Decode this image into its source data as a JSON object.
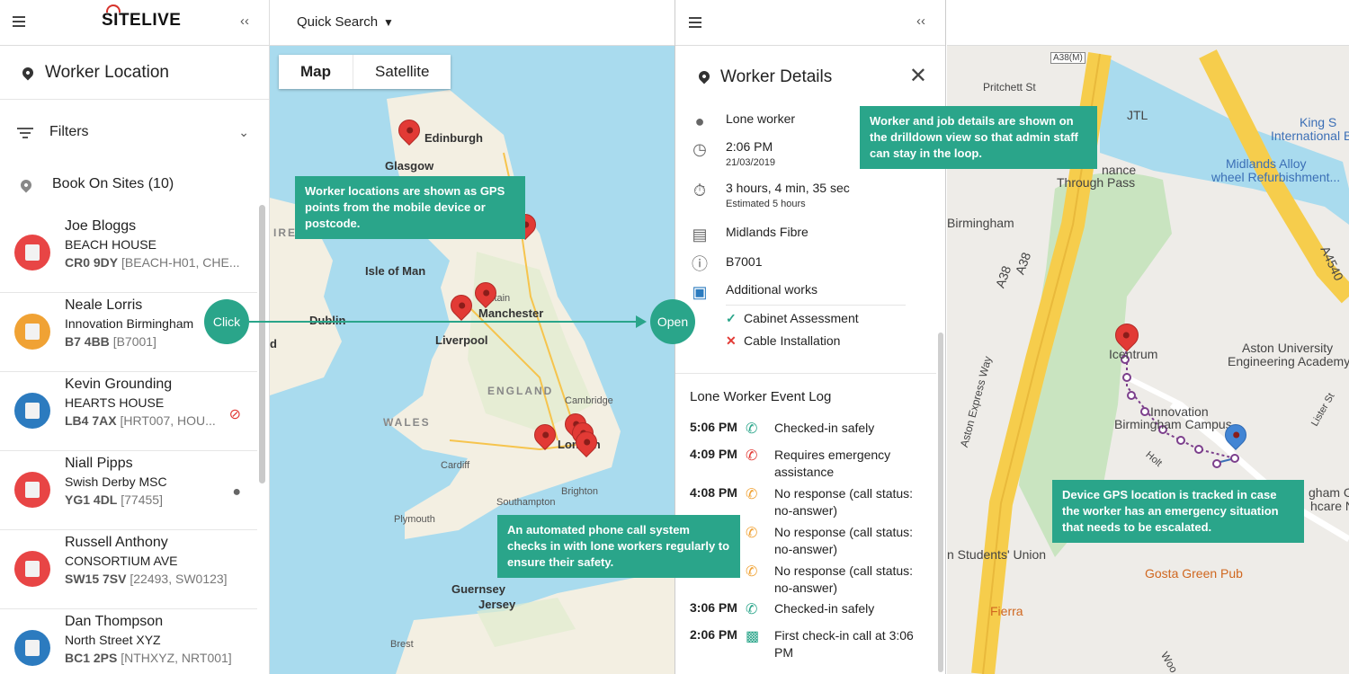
{
  "app": {
    "logo": "SITELIVE"
  },
  "left": {
    "title": "Worker Location",
    "filters_label": "Filters",
    "book_on_sites": "Book On Sites (10)",
    "workers": [
      {
        "name": "Joe Bloggs",
        "site": "BEACH HOUSE",
        "postcode": "CR0 9DY",
        "codes": "[BEACH-H01, CHE...",
        "avatar_color": "#e84545",
        "icon": ""
      },
      {
        "name": "Neale Lorris",
        "site": "Innovation Birmingham",
        "postcode": "B7 4BB",
        "codes": "[B7001]",
        "avatar_color": "#f0a234",
        "icon": ""
      },
      {
        "name": "Kevin Grounding",
        "site": "HEARTS HOUSE",
        "postcode": "LB4 7AX",
        "codes": "[HRT007, HOU...",
        "avatar_color": "#2c7bbf",
        "icon": "no-gps-icon"
      },
      {
        "name": "Niall Pipps",
        "site": "Swish Derby MSC",
        "postcode": "YG1 4DL",
        "codes": "[77455]",
        "avatar_color": "#e84545",
        "icon": "person-icon"
      },
      {
        "name": "Russell Anthony",
        "site": "CONSORTIUM AVE",
        "postcode": "SW15 7SV",
        "codes": "[22493, SW0123]",
        "avatar_color": "#e84545",
        "icon": ""
      },
      {
        "name": "Dan Thompson",
        "site": "North Street XYZ",
        "postcode": "BC1 2PS",
        "codes": "[NTHXYZ, NRT001]",
        "avatar_color": "#2c7bbf",
        "icon": ""
      }
    ]
  },
  "map": {
    "quick_search": "Quick Search",
    "tabs": [
      "Map",
      "Satellite"
    ],
    "labels": {
      "edinburgh": "Edinburgh",
      "glasgow": "Glasgow",
      "ireland": "IRELAND",
      "isle_of_man": "Isle of Man",
      "dublin": "Dublin",
      "d": "d",
      "liverpool": "Liverpool",
      "manchester": "Manchester",
      "britain": "Britain",
      "england": "ENGLAND",
      "wales": "WALES",
      "cambridge": "Cambridge",
      "cardiff": "Cardiff",
      "london": "London",
      "brighton": "Brighton",
      "southampton": "Southampton",
      "plymouth": "Plymouth",
      "guernsey": "Guernsey",
      "jersey": "Jersey",
      "brest": "Brest"
    }
  },
  "details": {
    "title": "Worker Details",
    "worker_type": "Lone worker",
    "time": "2:06 PM",
    "date": "21/03/2019",
    "duration": "3 hours, 4 min, 35 sec",
    "estimated": "Estimated 5 hours",
    "company": "Midlands Fibre",
    "job_code": "B7001",
    "works": "Additional works",
    "tasks": [
      {
        "label": "Cabinet Assessment",
        "status": "done",
        "mark": "✓",
        "color": "#2aa58a"
      },
      {
        "label": "Cable Installation",
        "status": "failed",
        "mark": "✕",
        "color": "#e23a35"
      }
    ],
    "log_title": "Lone Worker Event Log",
    "log": [
      {
        "time": "5:06 PM",
        "message": "Checked-in safely",
        "color": "#2aa58a"
      },
      {
        "time": "4:09 PM",
        "message": "Requires emergency assistance",
        "color": "#e23a35"
      },
      {
        "time": "4:08 PM",
        "message": "No response (call status: no-answer)",
        "color": "#f0a234"
      },
      {
        "time": "",
        "message": "No response (call status: no-answer)",
        "color": "#f0a234"
      },
      {
        "time": "",
        "message": "No response (call status: no-answer)",
        "color": "#f0a234"
      },
      {
        "time": "3:06 PM",
        "message": "Checked-in safely",
        "color": "#2aa58a"
      },
      {
        "time": "2:06 PM",
        "message": "First check-in call at 3:06 PM",
        "color": "#2aa58a"
      }
    ]
  },
  "street": {
    "labels": {
      "a38m": "A38(M)",
      "pritchett": "Pritchett St",
      "jtl": "JTL",
      "king_s": "King S",
      "intl_bus": "International Bus",
      "midlands_alloy": "Midlands Alloy",
      "wheel_ref": "wheel Refurbishment...",
      "nance": "nance",
      "through_pass": "Through Pass",
      "birmingham": "Birmingham",
      "a38a": "A38",
      "a38b": "A38",
      "a4540": "A4540",
      "aston_express": "Aston Express Way",
      "icentrum": "Icentrum",
      "aston_uni": "Aston University",
      "eng_academy": "Engineering Academy",
      "innovation": "Innovation",
      "birm_campus": "Birmingham Campus",
      "holt": "Holt",
      "lister": "Lister St",
      "gham": "gham C",
      "hcare": "hcare N",
      "students_union": "n Students' Union",
      "gosta": "Gosta Green Pub",
      "fierra": "Fierra",
      "woo": "Woo"
    }
  },
  "callouts": {
    "gps": "Worker locations are shown as GPS points from the mobile device or postcode.",
    "details": "Worker and job details are shown on the drilldown view so that admin staff can stay in the loop.",
    "phone": "An automated phone call system checks in with lone workers regularly to ensure their safety.",
    "device": "Device GPS location is tracked in case the worker has an emergency situation that needs to be escalated.",
    "click": "Click",
    "open": "Open"
  }
}
